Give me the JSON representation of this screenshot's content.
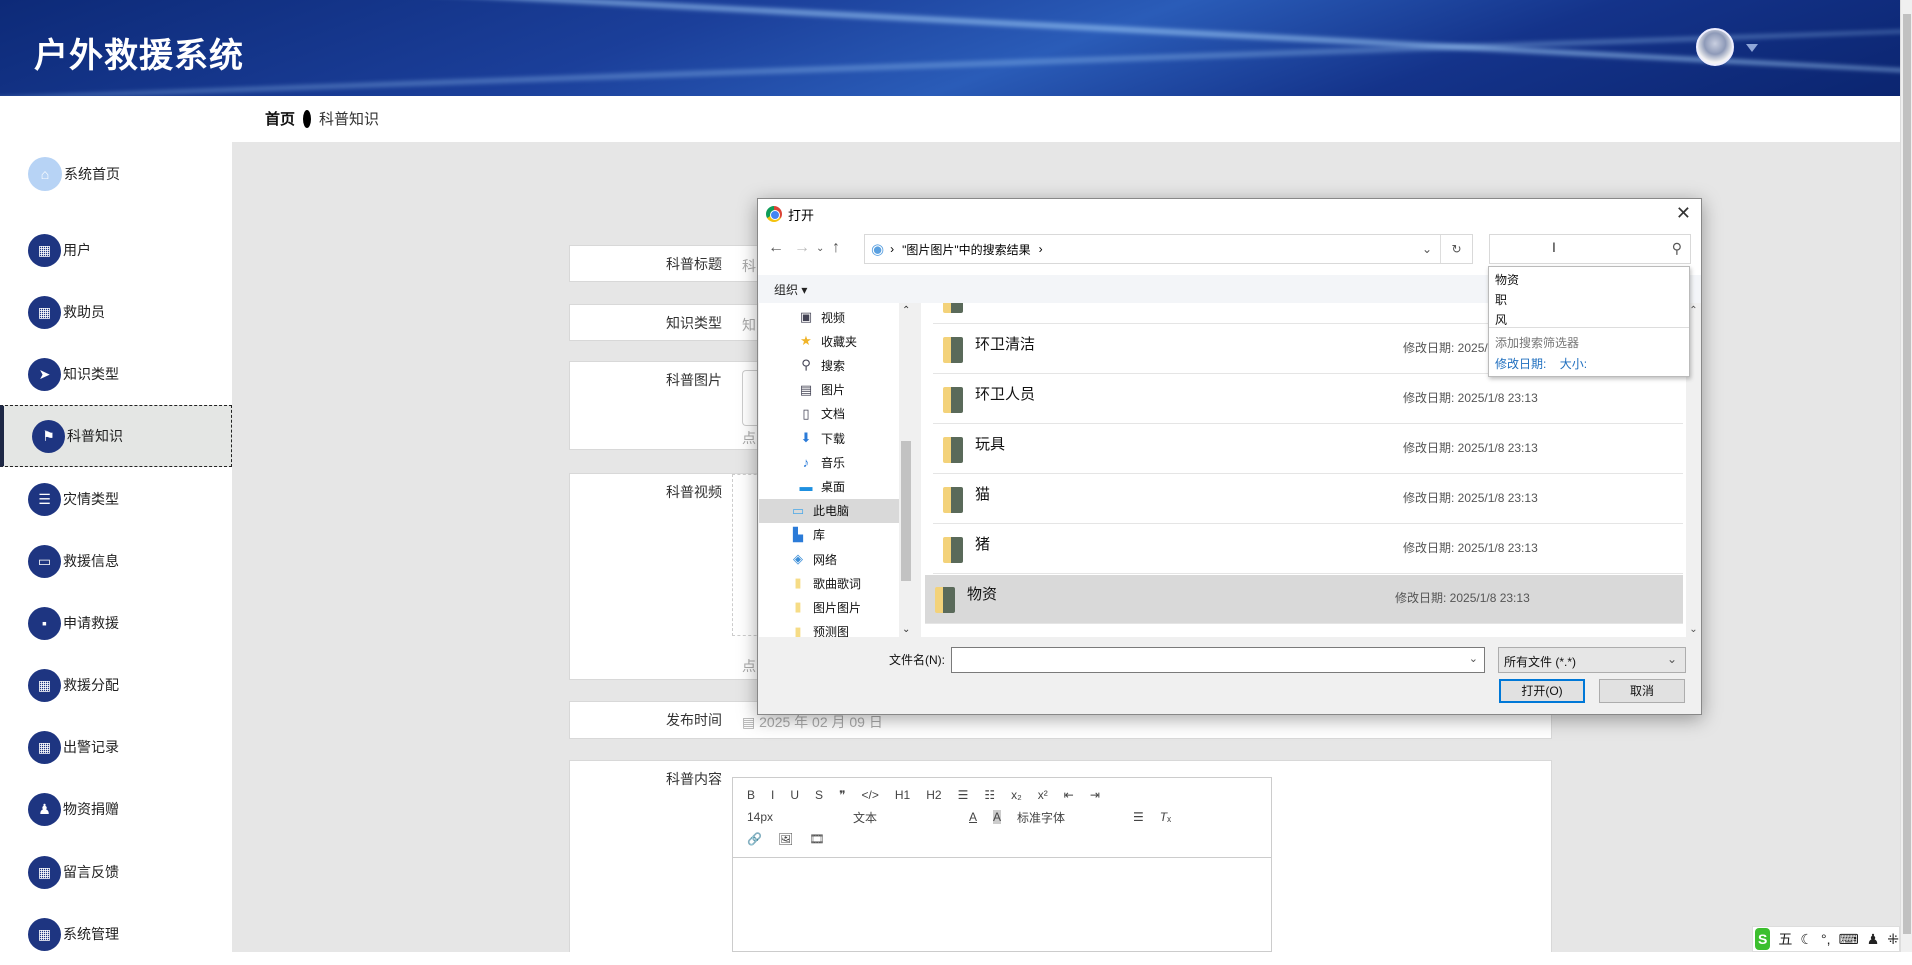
{
  "app": {
    "title": "户外救援系统"
  },
  "breadcrumb": {
    "home": "首页",
    "current": "科普知识"
  },
  "sidebar": {
    "items": [
      {
        "label": "系统首页",
        "icon": "home-icon"
      },
      {
        "label": "用户",
        "icon": "grid-icon"
      },
      {
        "label": "救助员",
        "icon": "grid-icon"
      },
      {
        "label": "知识类型",
        "icon": "paper-plane-icon"
      },
      {
        "label": "科普知识",
        "icon": "flag-icon",
        "active": true
      },
      {
        "label": "灾情类型",
        "icon": "list-icon"
      },
      {
        "label": "救援信息",
        "icon": "monitor-icon"
      },
      {
        "label": "申请救援",
        "icon": "chat-icon"
      },
      {
        "label": "救援分配",
        "icon": "grid-icon"
      },
      {
        "label": "出警记录",
        "icon": "grid-icon"
      },
      {
        "label": "物资捐赠",
        "icon": "user-stamp-icon"
      },
      {
        "label": "留言反馈",
        "icon": "grid-icon"
      },
      {
        "label": "系统管理",
        "icon": "grid-icon"
      }
    ]
  },
  "form": {
    "title_label": "科普标题",
    "title_placeholder": "科",
    "type_label": "知识类型",
    "type_placeholder": "知",
    "image_label": "科普图片",
    "image_hint": "点",
    "video_label": "科普视频",
    "video_hint": "点",
    "date_label": "发布时间",
    "date_value": "2025 年 02 月 09 日",
    "content_label": "科普内容",
    "editor": {
      "row1": [
        "B",
        "I",
        "U",
        "S",
        "❞",
        "</>",
        "H1",
        "H2",
        "☰",
        "☷",
        "x₂",
        "x²",
        "⇤",
        "⇥"
      ],
      "font_size": "14px",
      "text_style": "文本",
      "font_family": "标准字体",
      "row3": [
        "🔗",
        "🖼",
        "🎞"
      ]
    }
  },
  "dialog": {
    "title": "打开",
    "address": "\"图片图片\"中的搜索结果",
    "organize": "组织 ▾",
    "nav_items": [
      {
        "label": "视频",
        "icon": "video-icon"
      },
      {
        "label": "收藏夹",
        "icon": "star-icon"
      },
      {
        "label": "搜索",
        "icon": "search-icon"
      },
      {
        "label": "图片",
        "icon": "picture-icon"
      },
      {
        "label": "文档",
        "icon": "document-icon"
      },
      {
        "label": "下载",
        "icon": "download-icon"
      },
      {
        "label": "音乐",
        "icon": "music-icon"
      },
      {
        "label": "桌面",
        "icon": "desktop-icon"
      },
      {
        "label": "此电脑",
        "icon": "computer-icon",
        "selected": true
      },
      {
        "label": "库",
        "icon": "library-icon"
      },
      {
        "label": "网络",
        "icon": "network-icon"
      },
      {
        "label": "歌曲歌词",
        "icon": "folder-icon"
      },
      {
        "label": "图片图片",
        "icon": "folder-icon"
      },
      {
        "label": "预测图",
        "icon": "folder-icon"
      }
    ],
    "files": [
      {
        "name": "环卫清洁",
        "date": "修改日期: 2025/"
      },
      {
        "name": "环卫人员",
        "date": "修改日期: 2025/1/8 23:13"
      },
      {
        "name": "玩具",
        "date": "修改日期: 2025/1/8 23:13"
      },
      {
        "name": "猫",
        "date": "修改日期: 2025/1/8 23:13"
      },
      {
        "name": "猪",
        "date": "修改日期: 2025/1/8 23:13"
      },
      {
        "name": "物资",
        "date": "修改日期: 2025/1/8 23:13",
        "selected": true
      }
    ],
    "filename_label": "文件名(N):",
    "filename_value": "",
    "filetype": "所有文件 (*.*)",
    "open_button": "打开(O)",
    "cancel_button": "取消",
    "search_value": "",
    "suggestions": [
      "物资",
      "职",
      "风"
    ],
    "filter_title": "添加搜索筛选器",
    "filter_date": "修改日期:",
    "filter_size": "大小:"
  },
  "ime": {
    "mode": "五"
  }
}
